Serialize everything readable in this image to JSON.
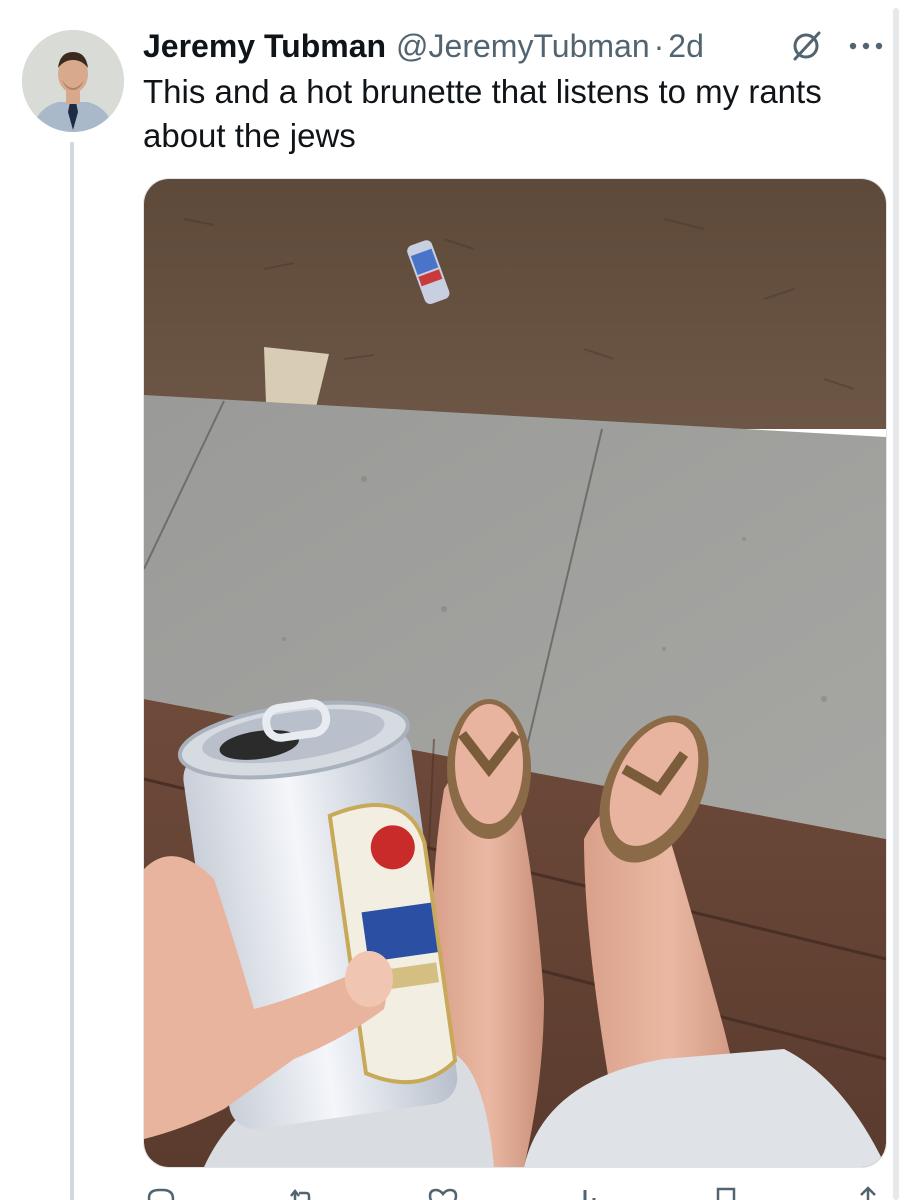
{
  "tweet": {
    "author_name": "Jeremy Tubman",
    "author_handle": "@JeremyTubman",
    "separator": "·",
    "timestamp": "2d",
    "text": "This and a hot brunette that listens to my rants about the jews"
  },
  "icons": {
    "edited": "edited-slash-circle-icon",
    "more": "more-dots-icon",
    "reply": "reply-icon",
    "retweet": "retweet-icon",
    "like": "heart-icon",
    "views": "views-bar-icon",
    "bookmark": "bookmark-icon",
    "share": "share-icon"
  },
  "colors": {
    "text_primary": "#0f1419",
    "text_secondary": "#536471",
    "thread_line": "#cfd9de"
  }
}
